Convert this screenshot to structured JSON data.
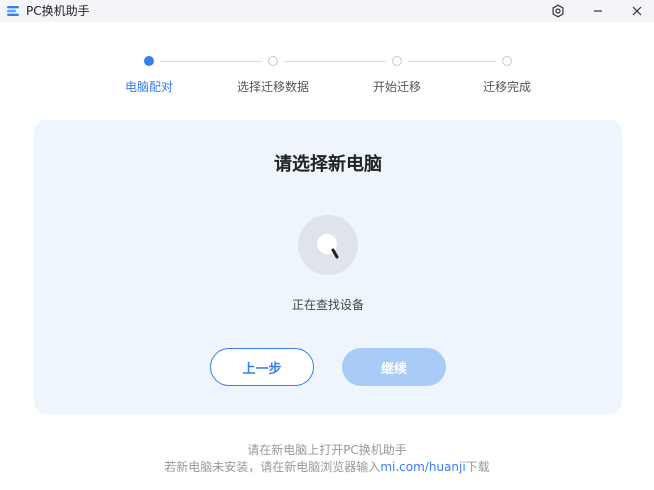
{
  "window": {
    "title": "PC换机助手",
    "logo_icon": "app-logo-icon",
    "settings_icon": "settings-icon",
    "minimize_icon": "minimize-icon",
    "close_icon": "close-icon"
  },
  "stepper": {
    "active_index": 0,
    "steps": [
      {
        "label": "电脑配对"
      },
      {
        "label": "选择迁移数据"
      },
      {
        "label": "开始迁移"
      },
      {
        "label": "迁移完成"
      }
    ]
  },
  "card": {
    "title": "请选择新电脑",
    "spinner_icon": "search-icon",
    "status": "正在查找设备",
    "prev_label": "上一步",
    "next_label": "继续"
  },
  "footer": {
    "line1": "请在新电脑上打开PC换机助手",
    "line2_prefix": "若新电脑未安装，请在新电脑浏览器输入",
    "link": "mi.com/huanji",
    "line2_suffix": "下载"
  },
  "colors": {
    "accent": "#3a7cf2",
    "disabled_button": "#a9cbf7",
    "card_bg": "#eef5fd"
  }
}
